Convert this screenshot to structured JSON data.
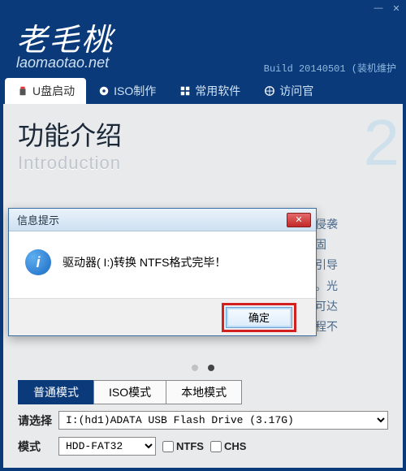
{
  "window_controls": {
    "minimize_glyph": "—",
    "close_glyph": "✕"
  },
  "header": {
    "brand_cn": "老毛桃",
    "brand_en": "laomaotao.net",
    "build": "Build 20140501 (装机维护"
  },
  "nav": {
    "tabs": [
      {
        "label": "U盘启动",
        "icon": "usb-icon"
      },
      {
        "label": "ISO制作",
        "icon": "disc-icon"
      },
      {
        "label": "常用软件",
        "icon": "apps-icon"
      },
      {
        "label": "访问官",
        "icon": "globe-icon"
      }
    ]
  },
  "intro": {
    "title_cn": "功能介绍",
    "title_en": "Introduction",
    "big_number": "2"
  },
  "features_right": [
    "事侵袭",
    "稳固",
    "桃引导",
    "径。光",
    "盘可达",
    "过程不"
  ],
  "slider": {
    "active_index": 1,
    "count": 2
  },
  "modes": {
    "tabs": [
      "普通模式",
      "ISO模式",
      "本地模式"
    ],
    "active": 0
  },
  "form": {
    "select_label": "请选择",
    "drive_value": "I:(hd1)ADATA USB Flash Drive (3.17G)",
    "mode_label": "模式",
    "fs_value": "HDD-FAT32",
    "ntfs_label": "NTFS",
    "chs_label": "CHS"
  },
  "modal": {
    "title": "信息提示",
    "message": "驱动器( I:)转换 NTFS格式完毕！",
    "ok_label": "确定"
  }
}
